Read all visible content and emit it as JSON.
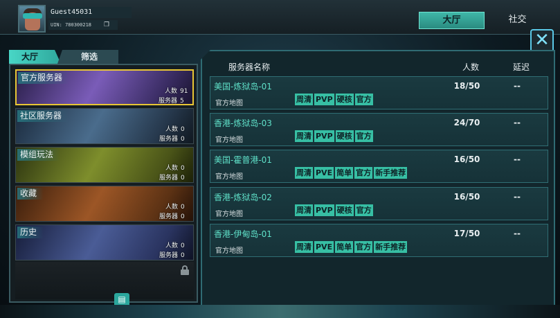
{
  "profile": {
    "username": "Guest45031",
    "uin": "UIN: 780300218"
  },
  "top_tabs": [
    {
      "label": "大厅",
      "active": true
    },
    {
      "label": "社交",
      "active": false
    }
  ],
  "close_label": "✕",
  "left_tabs": [
    {
      "label": "大厅",
      "active": true
    },
    {
      "label": "筛选",
      "active": false
    }
  ],
  "categories": [
    {
      "name": "官方服务器",
      "people_label": "人数",
      "people": "91",
      "servers_label": "服务器",
      "servers": "5",
      "selected": true,
      "color": "#6b4fa0"
    },
    {
      "name": "社区服务器",
      "people_label": "人数",
      "people": "0",
      "servers_label": "服务器",
      "servers": "0",
      "selected": false,
      "color": "#3a5a80"
    },
    {
      "name": "模组玩法",
      "people_label": "人数",
      "people": "0",
      "servers_label": "服务器",
      "servers": "0",
      "selected": false,
      "color": "#6a7a2a"
    },
    {
      "name": "收藏",
      "people_label": "人数",
      "people": "0",
      "servers_label": "服务器",
      "servers": "0",
      "selected": false,
      "color": "#8a4a22"
    },
    {
      "name": "历史",
      "people_label": "人数",
      "people": "0",
      "servers_label": "服务器",
      "servers": "0",
      "selected": false,
      "color": "#3a4a7a"
    }
  ],
  "server_table": {
    "headers": {
      "name": "服务器名称",
      "people": "人数",
      "latency": "延迟"
    },
    "rows": [
      {
        "name": "美国-炼狱岛-01",
        "map": "官方地图",
        "tags": [
          "周清",
          "PVP",
          "硬核",
          "官方"
        ],
        "count": "18/50",
        "latency": "--"
      },
      {
        "name": "香港-炼狱岛-03",
        "map": "官方地图",
        "tags": [
          "周清",
          "PVP",
          "硬核",
          "官方"
        ],
        "count": "24/70",
        "latency": "--"
      },
      {
        "name": "美国-霍普港-01",
        "map": "官方地图",
        "tags": [
          "周清",
          "PVE",
          "简单",
          "官方",
          "新手推荐"
        ],
        "count": "16/50",
        "latency": "--"
      },
      {
        "name": "香港-炼狱岛-02",
        "map": "官方地图",
        "tags": [
          "周清",
          "PVP",
          "硬核",
          "官方"
        ],
        "count": "16/50",
        "latency": "--"
      },
      {
        "name": "香港-伊甸岛-01",
        "map": "官方地图",
        "tags": [
          "周清",
          "PVE",
          "简单",
          "官方",
          "新手推荐"
        ],
        "count": "17/50",
        "latency": "--"
      }
    ]
  },
  "icons": {
    "copy": "copy-icon",
    "lock": "lock-icon",
    "chat": "chat-icon",
    "close": "close-icon"
  },
  "colors": {
    "accent": "#37bfa4",
    "selected_border": "#e8c634",
    "server_name": "#5fe0c8"
  }
}
